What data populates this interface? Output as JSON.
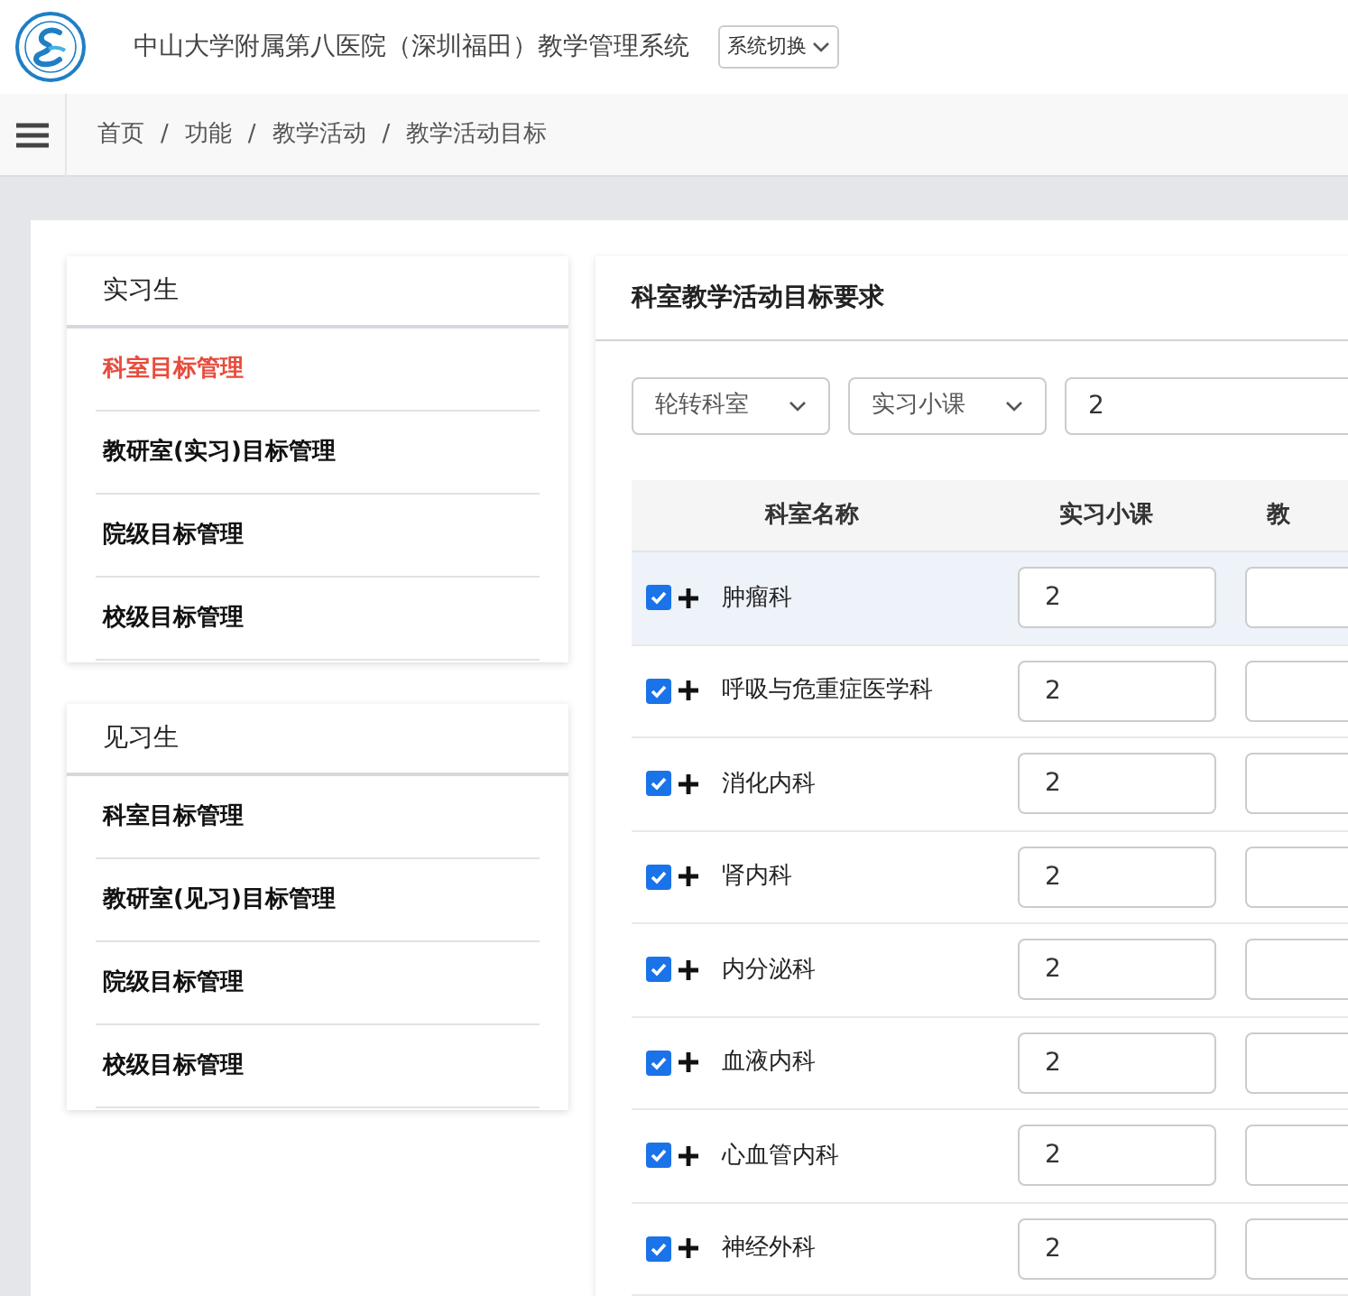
{
  "header": {
    "title": "中山大学附属第八医院（深圳福田）教学管理系统",
    "switch_button": "系统切换"
  },
  "breadcrumb": {
    "separator": "/",
    "items": [
      "首页",
      "功能",
      "教学活动",
      "教学活动目标"
    ]
  },
  "sidebar": [
    {
      "title": "实习生",
      "items": [
        {
          "label": "科室目标管理",
          "selected": true
        },
        {
          "label": "教研室(实习)目标管理",
          "selected": false
        },
        {
          "label": "院级目标管理",
          "selected": false
        },
        {
          "label": "校级目标管理",
          "selected": false
        }
      ]
    },
    {
      "title": "见习生",
      "items": [
        {
          "label": "科室目标管理",
          "selected": false
        },
        {
          "label": "教研室(见习)目标管理",
          "selected": false
        },
        {
          "label": "院级目标管理",
          "selected": false
        },
        {
          "label": "校级目标管理",
          "selected": false
        }
      ]
    }
  ],
  "panel": {
    "title": "科室教学活动目标要求",
    "filters": {
      "department_select": "轮转科室",
      "type_select": "实习小课",
      "value_input": "2"
    },
    "table": {
      "columns": [
        "科室名称",
        "实习小课",
        "教"
      ],
      "rows": [
        {
          "name": "肿瘤科",
          "checked": true,
          "selected": true,
          "value": "2"
        },
        {
          "name": "呼吸与危重症医学科",
          "checked": true,
          "selected": false,
          "value": "2"
        },
        {
          "name": "消化内科",
          "checked": true,
          "selected": false,
          "value": "2"
        },
        {
          "name": "肾内科",
          "checked": true,
          "selected": false,
          "value": "2"
        },
        {
          "name": "内分泌科",
          "checked": true,
          "selected": false,
          "value": "2"
        },
        {
          "name": "血液内科",
          "checked": true,
          "selected": false,
          "value": "2"
        },
        {
          "name": "心血管内科",
          "checked": true,
          "selected": false,
          "value": "2"
        },
        {
          "name": "神经外科",
          "checked": true,
          "selected": false,
          "value": "2"
        }
      ]
    }
  }
}
